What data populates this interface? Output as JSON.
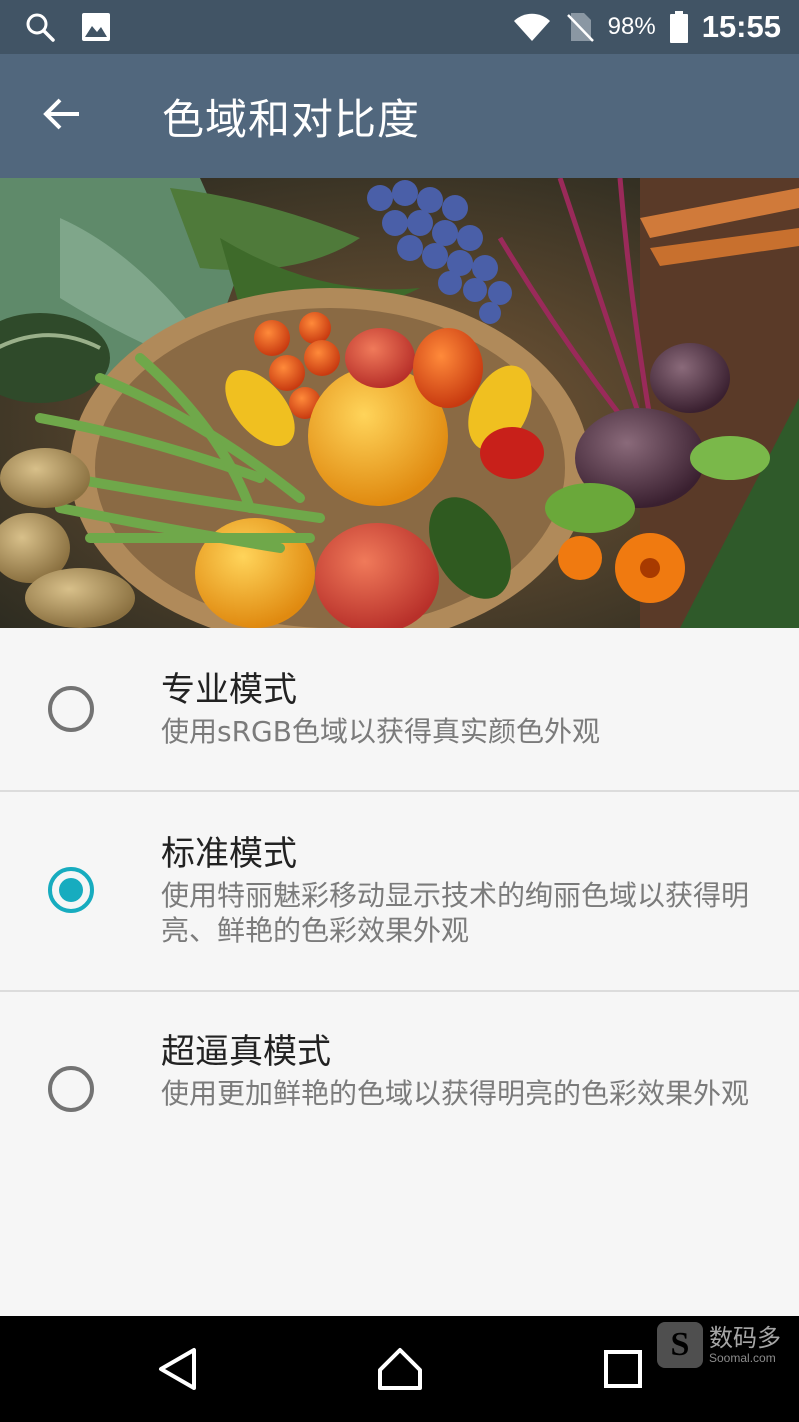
{
  "status_bar": {
    "left_icons": [
      "search-icon",
      "image-icon"
    ],
    "right_icons": [
      "wifi-icon",
      "no-sim-icon",
      "battery-icon"
    ],
    "battery_percent": "98%",
    "time": "15:55"
  },
  "app_bar": {
    "back_icon": "arrow-left-icon",
    "title": "色域和对比度"
  },
  "hero_image": {
    "subject": "basket of vegetables (tomatoes, grapes, green beans, potatoes, beets, zucchini, nasturtium flowers)"
  },
  "options": [
    {
      "title": "专业模式",
      "description": "使用sRGB色域以获得真实颜色外观",
      "selected": false
    },
    {
      "title": "标准模式",
      "description": "使用特丽魅彩移动显示技术的绚丽色域以获得明亮、鲜艳的色彩效果外观",
      "selected": true
    },
    {
      "title": "超逼真模式",
      "description": "使用更加鲜艳的色域以获得明亮的色彩效果外观",
      "selected": false
    }
  ],
  "nav_bar": {
    "buttons": [
      "back-triangle-icon",
      "home-icon",
      "recents-icon"
    ]
  },
  "watermark": {
    "logo_letter": "S",
    "text": "数码多",
    "sub": "Soomal.com"
  },
  "colors": {
    "status_bar": "#415465",
    "app_bar": "#51677d",
    "accent": "#17acbf",
    "background": "#f6f6f6"
  }
}
